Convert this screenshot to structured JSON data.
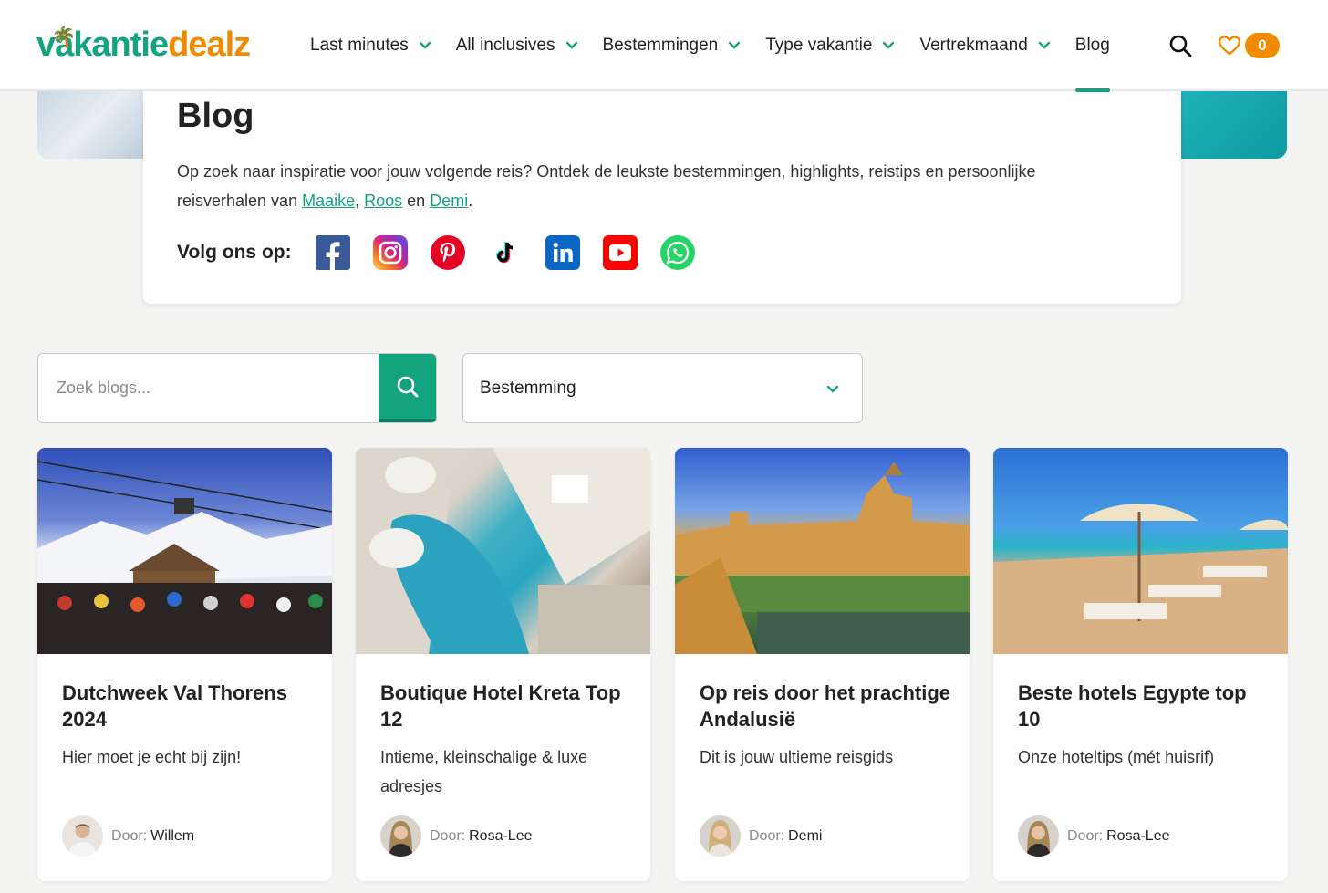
{
  "header": {
    "logo_a": "vakantie",
    "logo_b": "dealz",
    "nav": [
      {
        "label": "Last minutes"
      },
      {
        "label": "All inclusives"
      },
      {
        "label": "Bestemmingen"
      },
      {
        "label": "Type vakantie"
      },
      {
        "label": "Vertrekmaand"
      },
      {
        "label": "Blog"
      }
    ],
    "fav_count": "0"
  },
  "intro": {
    "title": "Blog",
    "text_before": "Op zoek naar inspiratie voor jouw volgende reis? Ontdek de leukste bestemmingen, highlights, reistips en persoonlijke reisverhalen van ",
    "link1": "Maaike",
    "sep1": ", ",
    "link2": "Roos",
    "sep2": " en ",
    "link3": "Demi",
    "end": ".",
    "follow_label": "Volg ons op:"
  },
  "filters": {
    "search_placeholder": "Zoek blogs...",
    "select_value": "Bestemming"
  },
  "cards": [
    {
      "title": "Dutchweek Val Thorens 2024",
      "subtitle": "Hier moet je echt bij zijn!",
      "door": "Door:",
      "author": "Willem"
    },
    {
      "title": "Boutique Hotel Kreta Top 12",
      "subtitle": "Intieme, kleinschalige & luxe adresjes",
      "door": "Door:",
      "author": "Rosa-Lee"
    },
    {
      "title": "Op reis door het prachtige Andalusië",
      "subtitle": "Dit is jouw ultieme reisgids",
      "door": "Door:",
      "author": "Demi"
    },
    {
      "title": "Beste hotels Egypte top 10",
      "subtitle": "Onze hoteltips (mét huisrif)",
      "door": "Door:",
      "author": "Rosa-Lee"
    }
  ],
  "colors": {
    "brand_green": "#14a37f",
    "brand_orange": "#f08a00"
  }
}
